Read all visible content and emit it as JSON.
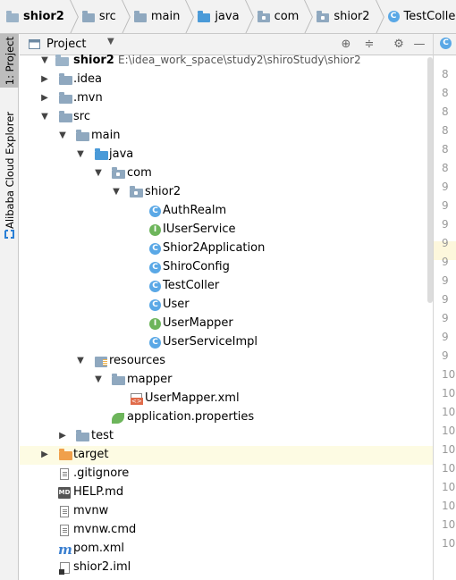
{
  "breadcrumb": [
    {
      "label": "shior2",
      "icon": "module-folder-icon"
    },
    {
      "label": "src",
      "icon": "folder-icon"
    },
    {
      "label": "main",
      "icon": "folder-icon"
    },
    {
      "label": "java",
      "icon": "source-folder-icon"
    },
    {
      "label": "com",
      "icon": "package-icon"
    },
    {
      "label": "shior2",
      "icon": "package-icon"
    },
    {
      "label": "TestColler",
      "icon": "class-icon"
    }
  ],
  "toolstrip": {
    "project_tab": "1: Project",
    "cloud_tab": "Alibaba Cloud Explorer"
  },
  "panel": {
    "title": "Project",
    "buttons": [
      "target-icon",
      "collapse-icon",
      "gear-icon",
      "hide-icon"
    ]
  },
  "tree": {
    "root_name": "shior2",
    "root_path": "E:\\idea_work_space\\study2\\shiroStudy\\shior2",
    "idea": ".idea",
    "mvn": ".mvn",
    "src": "src",
    "main": "main",
    "java": "java",
    "com": "com",
    "shior2_pkg": "shior2",
    "classes": [
      {
        "name": "AuthRealm",
        "kind": "C"
      },
      {
        "name": "IUserService",
        "kind": "I"
      },
      {
        "name": "Shior2Application",
        "kind": "C"
      },
      {
        "name": "ShiroConfig",
        "kind": "C"
      },
      {
        "name": "TestColler",
        "kind": "C"
      },
      {
        "name": "User",
        "kind": "C"
      },
      {
        "name": "UserMapper",
        "kind": "I"
      },
      {
        "name": "UserServiceImpl",
        "kind": "C"
      }
    ],
    "resources": "resources",
    "mapper": "mapper",
    "usermapper_xml": "UserMapper.xml",
    "app_props": "application.properties",
    "test": "test",
    "target": "target",
    "gitignore": ".gitignore",
    "help": "HELP.md",
    "mvnw": "mvnw",
    "mvnw_cmd": "mvnw.cmd",
    "pom": "pom.xml",
    "iml": "shior2.iml"
  },
  "editor": {
    "line_numbers": [
      "8",
      "8",
      "8",
      "8",
      "8",
      "8",
      "9",
      "9",
      "9",
      "9",
      "9",
      "9",
      "9",
      "9",
      "9",
      "9",
      "10",
      "10",
      "10",
      "10",
      "10",
      "10",
      "10",
      "10",
      "10",
      "10"
    ]
  }
}
